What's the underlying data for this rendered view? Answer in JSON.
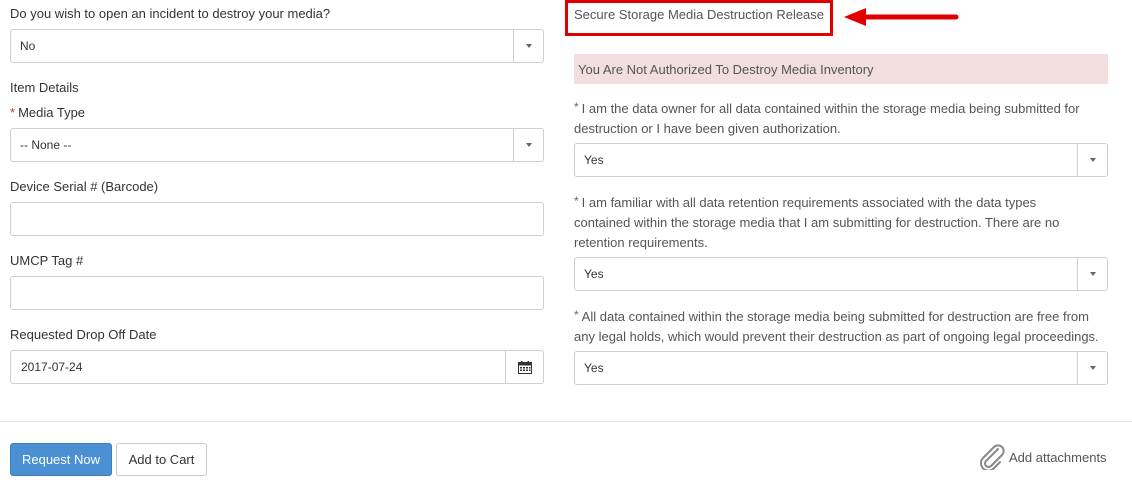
{
  "left": {
    "incident_question": "Do you wish to open an incident to destroy your media?",
    "incident_value": "No",
    "item_details": "Item Details",
    "media_type_label": "Media Type",
    "media_type_value": "-- None --",
    "serial_label": "Device Serial # (Barcode)",
    "serial_value": "",
    "tag_label": "UMCP Tag #",
    "tag_value": "",
    "date_label": "Requested Drop Off Date",
    "date_value": "2017-07-24"
  },
  "right": {
    "section_title": "Secure Storage Media Destruction Release",
    "alert": "You Are Not Authorized To Destroy Media Inventory",
    "q1_line1": "I am the data owner for all data contained within the storage media being submitted for",
    "q1_line2": "destruction or I have been given authorization.",
    "q1_value": "Yes",
    "q2_line1": "I am familiar with all data retention requirements associated with the data types",
    "q2_line2": "contained within the storage media that I am submitting for destruction. There are no",
    "q2_line3": "retention requirements.",
    "q2_value": "Yes",
    "q3_line1": "All data contained within the storage media being submitted for destruction are free from",
    "q3_line2": "any legal holds, which would prevent their destruction as part of ongoing legal proceedings.",
    "q3_value": "Yes"
  },
  "footer": {
    "request_now": "Request Now",
    "add_to_cart": "Add to Cart",
    "add_attachments": "Add attachments"
  },
  "colors": {
    "primary": "#4a90d2",
    "alert_bg": "#f2dede",
    "annotation_red": "#e00000"
  },
  "icons": [
    "calendar-icon",
    "paperclip-icon",
    "chevron-down-icon",
    "arrow-annotation"
  ]
}
